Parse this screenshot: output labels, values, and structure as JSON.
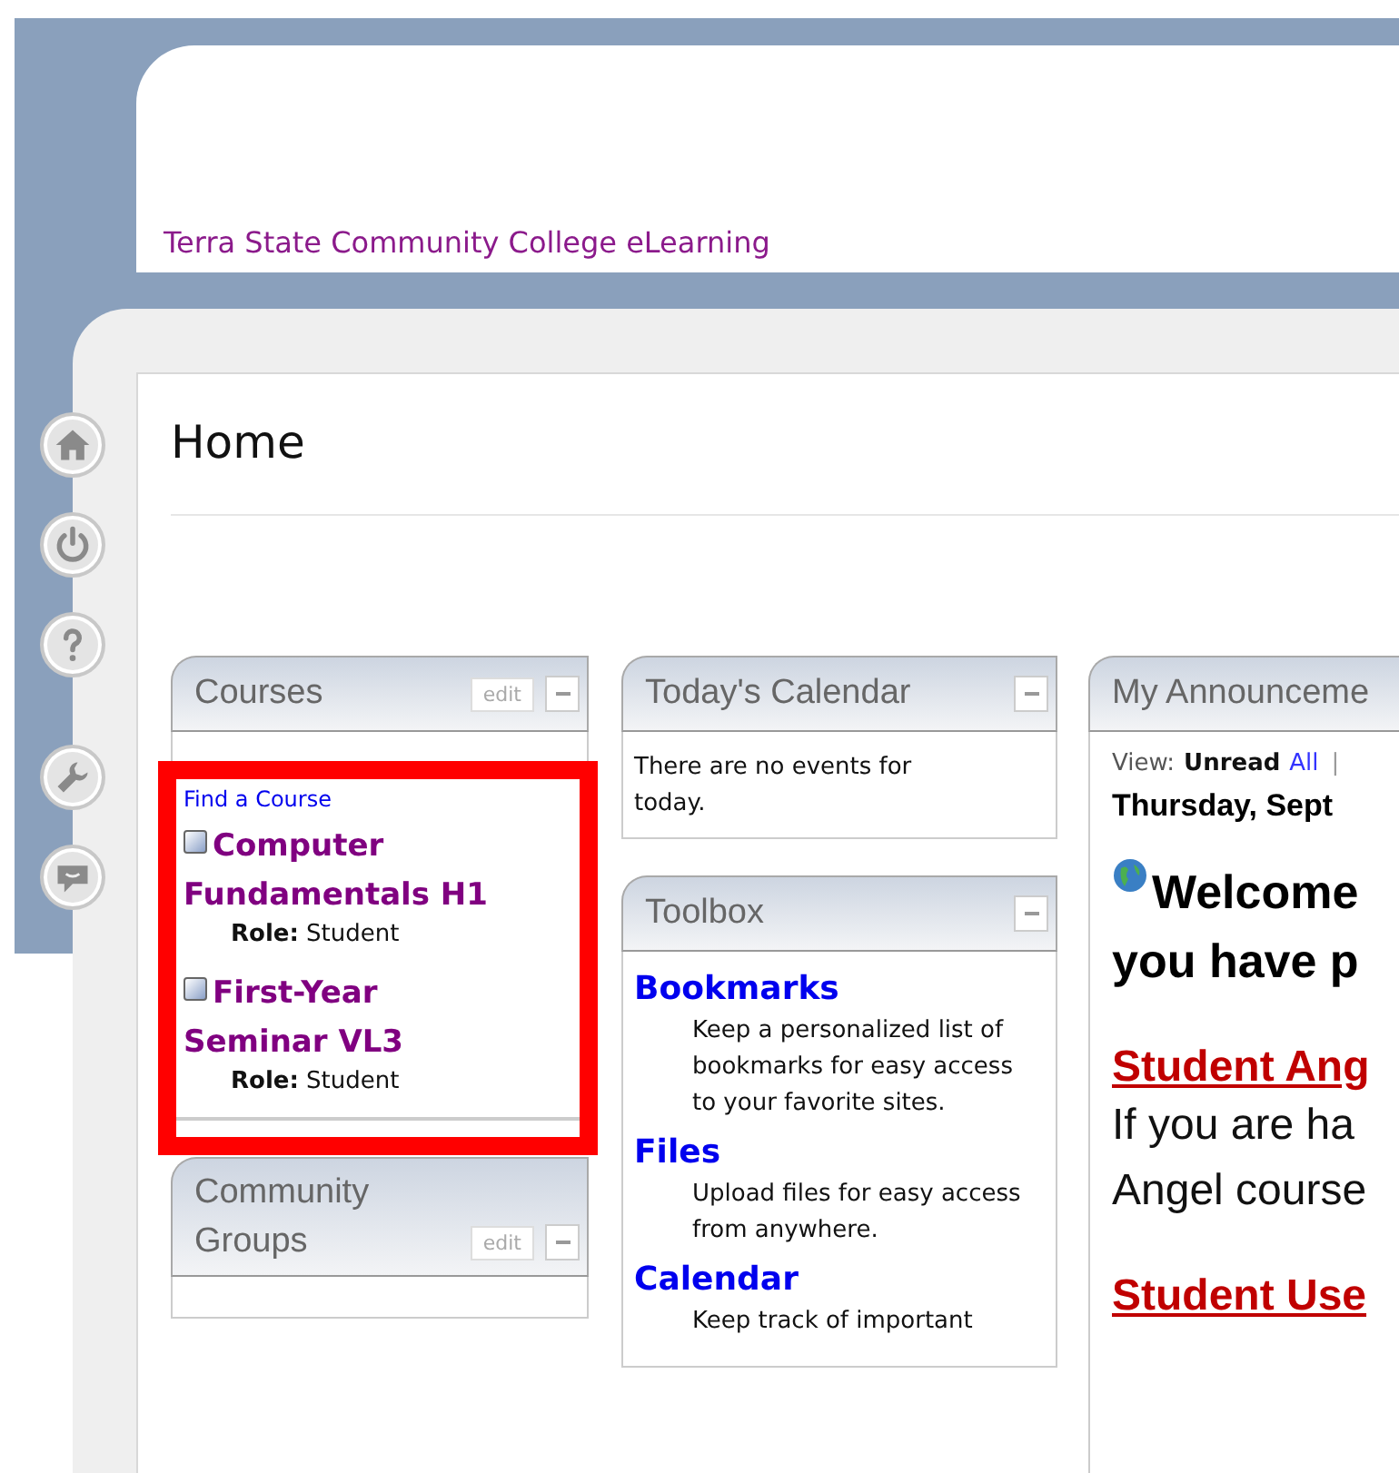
{
  "header": {
    "site_title": "Terra State Community College eLearning"
  },
  "page": {
    "title": "Home"
  },
  "courses_portlet": {
    "title": "Courses",
    "edit": "edit",
    "find_link": "Find a Course",
    "courses": [
      {
        "name": "Computer Fundamentals H1",
        "role": "**Role:** Student"
      },
      {
        "name": "First-Year Seminar VL3",
        "role": "**Role:** Student"
      }
    ]
  },
  "community_portlet": {
    "title": "Community Groups",
    "edit": "edit"
  },
  "calendar_portlet": {
    "title": "Today's Calendar",
    "message": "There are no events for today."
  },
  "toolbox_portlet": {
    "title": "Toolbox",
    "items": [
      {
        "title": "Bookmarks",
        "description": "Keep a personalized list of bookmarks for easy access to your favorite sites."
      },
      {
        "title": "Files",
        "description": "Upload files for easy access from anywhere."
      },
      {
        "title": "Calendar",
        "description": "Keep track of important"
      }
    ]
  },
  "announcements_portlet": {
    "title": "My Announceme",
    "view_label": "View:",
    "filters": [
      {
        "label": "Unread",
        "selected": true
      },
      {
        "label": "All",
        "selected": false
      }
    ],
    "separator": "|",
    "date": "Thursday, Sept",
    "headline": [
      "Welcome",
      "you have p"
    ],
    "sections": [
      {
        "heading": "Student Ang",
        "lines": [
          "If you are ha",
          "Angel course"
        ]
      },
      {
        "heading": "Student Use"
      }
    ]
  }
}
